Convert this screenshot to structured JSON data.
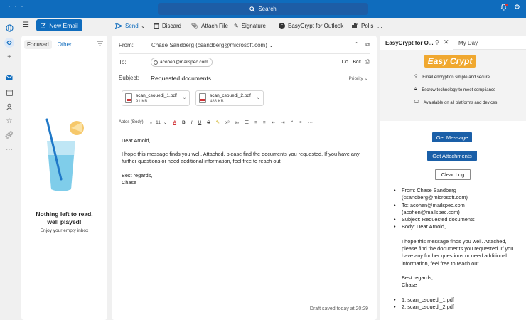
{
  "titlebar": {
    "search_label": "Search"
  },
  "command_bar": {
    "new_email": "New Email",
    "send": "Send",
    "discard": "Discard",
    "attach_file": "Attach File",
    "signature": "Signature",
    "easycrypt": "EasyCrypt for Outlook",
    "polls": "Polls",
    "more": "..."
  },
  "message_list": {
    "tab_focused": "Focused",
    "tab_other": "Other",
    "empty_title_line1": "Nothing left to read,",
    "empty_title_line2": "well played!",
    "empty_subtitle": "Enjoy your empty inbox"
  },
  "compose": {
    "from_label": "From:",
    "from_value": "Chase Sandberg (csandberg@microsoft.com)",
    "to_label": "To:",
    "to_recipient": "acohen@mailspec.com",
    "cc": "Cc",
    "bcc": "Bcc",
    "subject_label": "Subject:",
    "subject_value": "Requested documents",
    "priority": "Priority",
    "attachments": [
      {
        "name": "scan_csouedi_1.pdf",
        "size": "91 KB"
      },
      {
        "name": "scan_csouedi_2.pdf",
        "size": "483 KB"
      }
    ],
    "font_name": "Aptos (Body)",
    "font_size": "11",
    "greeting": "Dear Arnold,",
    "body_line1": "I hope this message finds you well. Attached, please find the documents you requested. If you have any",
    "body_line2": "further questions or need additional information, feel free to reach out.",
    "closing": "Best regards,",
    "signature_name": "Chase",
    "draft_status": "Draft saved today at 20:29"
  },
  "addin": {
    "tab_title": "EasyCrypt for O...",
    "tab_myday": "My Day",
    "logo_text": "Easy Crypt",
    "features": [
      "Email encryption simple and secure",
      "Escrow technology to meet compliance",
      "Avaialable on all platforms and devices"
    ],
    "btn_get_message": "Get Message",
    "btn_get_attachments": "Get Attachments",
    "btn_clear_log": "Clear Log",
    "log": {
      "from_line1": "From: Chase Sandberg",
      "from_line2": "(csandberg@microsoft.com)",
      "to_line1": "To: acohen@mailspec.com",
      "to_line2": "(acohen@mailspec.com)",
      "subject": "Subject: Requested documents",
      "body_label": "Body: Dear Arnold,",
      "body_line1": "I hope this message finds you well. Attached,",
      "body_line2": "please find the documents you requested. If you",
      "body_line3": "have any further questions or need additional",
      "body_line4": "information, feel free to reach out.",
      "closing": "Best regards,",
      "name": "Chase",
      "attach1": "1: scan_csouedi_1.pdf",
      "attach2": "2: scan_csouedi_2.pdf"
    }
  }
}
